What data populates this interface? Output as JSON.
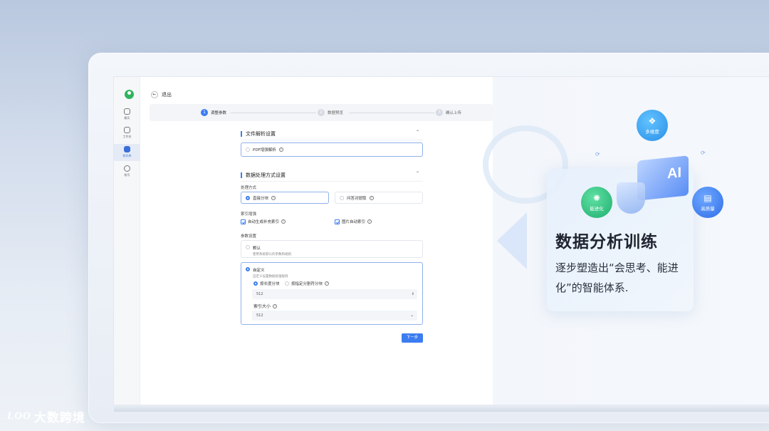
{
  "sidebar": {
    "items": [
      {
        "icon": "chat-icon",
        "label": "聊天"
      },
      {
        "icon": "workbench-icon",
        "label": "工作台"
      },
      {
        "icon": "database-icon",
        "label": "知识库"
      },
      {
        "icon": "account-icon",
        "label": "账号"
      }
    ]
  },
  "header": {
    "back_label": "退出"
  },
  "steps": [
    {
      "num": "1",
      "label": "调整参数"
    },
    {
      "num": "2",
      "label": "数据预览"
    },
    {
      "num": "3",
      "label": "确认上传"
    }
  ],
  "file_parse": {
    "title": "文件解析设置",
    "pdf_label": "PDF增强解析"
  },
  "data_process": {
    "title": "数据处理方式设置",
    "method_label": "处理方式",
    "method_options": [
      "直接分块",
      "问答对提取"
    ],
    "index_label": "索引增强",
    "index_options": [
      "自动生成补充索引",
      "图片自动索引"
    ],
    "param_label": "参数设置",
    "default_title": "默认",
    "default_sub": "使用系统默认的参数和规则",
    "custom_title": "自定义",
    "custom_sub": "自定义设置数据处理规则",
    "chunk_options": [
      "按长度分块",
      "按指定分割符分块"
    ],
    "chunk_value": "512",
    "index_size_label": "索引大小",
    "index_size_value": "512"
  },
  "next_button": "下一步",
  "promo": {
    "title": "数据分析训练",
    "subtitle": "逐步塑造出“会思考、能进化”的智能体系.",
    "badges": [
      "多维度",
      "能进化",
      "高质量"
    ],
    "ai_text": "AI"
  },
  "brand": {
    "mark": "LOO",
    "name": "大数跨境"
  },
  "colors": {
    "accent": "#3b7cf0",
    "green": "#2fb35f"
  }
}
